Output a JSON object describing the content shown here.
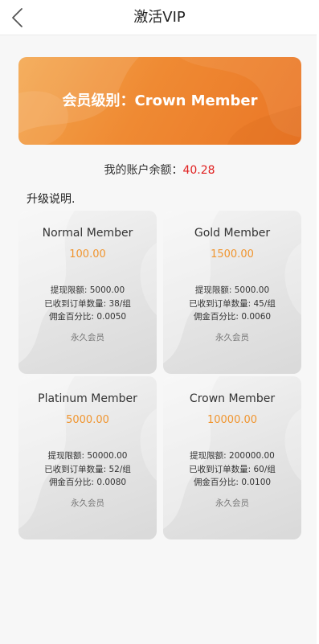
{
  "header": {
    "title": "激活VIP",
    "back_icon": "chevron-left-icon"
  },
  "banner": {
    "label": "会员级别：",
    "level": "Crown Member",
    "colors": {
      "from": "#f3a64d",
      "to": "#ea7626"
    }
  },
  "balance": {
    "label": "我的账户余额：",
    "amount": "40.28",
    "amount_color": "#e02020"
  },
  "upgrade": {
    "title": "升级说明."
  },
  "plans": [
    {
      "name": "Normal Member",
      "price": "100.00",
      "withdraw_limit": "提现限额: 5000.00",
      "orders": "已收到订单数量: 38/组",
      "commission": "佣金百分比: 0.0050",
      "term": "永久会员"
    },
    {
      "name": "Gold Member",
      "price": "1500.00",
      "withdraw_limit": "提现限额: 5000.00",
      "orders": "已收到订单数量: 45/组",
      "commission": "佣金百分比: 0.0060",
      "term": "永久会员"
    },
    {
      "name": "Platinum Member",
      "price": "5000.00",
      "withdraw_limit": "提现限额: 50000.00",
      "orders": "已收到订单数量: 52/组",
      "commission": "佣金百分比: 0.0080",
      "term": "永久会员"
    },
    {
      "name": "Crown Member",
      "price": "10000.00",
      "withdraw_limit": "提现限额: 200000.00",
      "orders": "已收到订单数量: 60/组",
      "commission": "佣金百分比: 0.0100",
      "term": "永久会员"
    }
  ],
  "price_color": "#f0952f"
}
